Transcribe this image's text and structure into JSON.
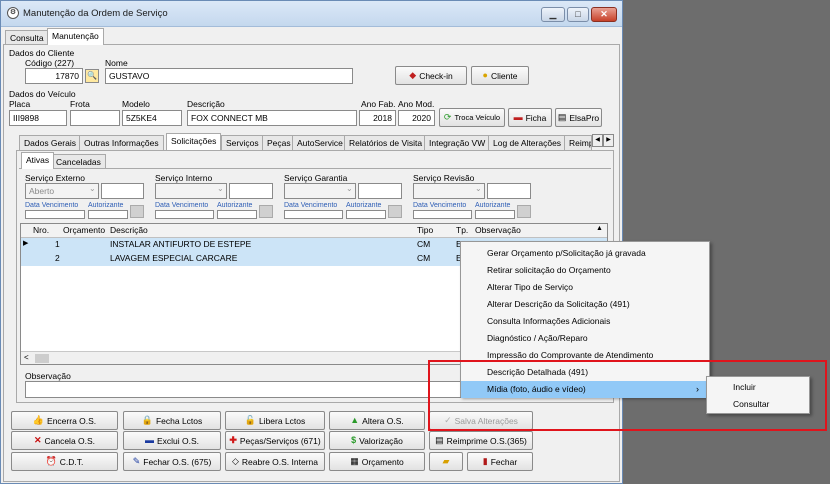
{
  "window": {
    "title": "Manutenção da Ordem de Serviço",
    "buttons": {
      "minimize": "▁",
      "maximize": "□",
      "close": "✕"
    }
  },
  "top_tabs": [
    "Consulta",
    "Manutenção"
  ],
  "cliente": {
    "section": "Dados do Cliente",
    "codigo_label": "Código (227)",
    "codigo": "17870",
    "nome_label": "Nome",
    "nome": "GUSTAVO",
    "checkin_label": "Check-in",
    "cliente_label": "Cliente"
  },
  "veiculo": {
    "section": "Dados do Veículo",
    "placa_label": "Placa",
    "placa": "III9898",
    "frota_label": "Frota",
    "frota": "",
    "modelo_label": "Modelo",
    "modelo": "5Z5KE4",
    "descricao_label": "Descrição",
    "descricao": "FOX CONNECT MB",
    "anofab_label": "Ano Fab.",
    "anofab": "2018",
    "anomod_label": "Ano Mod.",
    "anomod": "2020",
    "troca_label": "Troca Veículo",
    "ficha_label": "Ficha",
    "elsapro_label": "ElsaPro"
  },
  "main_tabs": [
    "Dados Gerais",
    "Outras Informações",
    "Solicitações",
    "Serviços",
    "Peças",
    "AutoService",
    "Relatórios de Visita",
    "Integração VW",
    "Log de Alterações",
    "Reimp"
  ],
  "sub_tabs": [
    "Ativas",
    "Canceladas"
  ],
  "servicos": [
    {
      "title": "Serviço Externo",
      "value": "Aberto"
    },
    {
      "title": "Serviço Interno",
      "value": ""
    },
    {
      "title": "Serviço Garantia",
      "value": ""
    },
    {
      "title": "Serviço Revisão",
      "value": ""
    }
  ],
  "data_vencimento": "Data Vencimento",
  "autorizante": "Autorizante",
  "grid": {
    "headers": {
      "nro": "Nro.",
      "orcamento": "Orçamento",
      "descricao": "Descrição",
      "tipo": "Tipo",
      "tp": "Tp.",
      "observacao": "Observação"
    },
    "rows": [
      {
        "nro": "1",
        "orcamento": "",
        "descricao": "INSTALAR ANTIFURTO DE ESTEPE",
        "tipo": "CM",
        "tp": "E"
      },
      {
        "nro": "2",
        "orcamento": "",
        "descricao": "LAVAGEM ESPECIAL CARCARE",
        "tipo": "CM",
        "tp": "E"
      }
    ]
  },
  "observacao_label": "Observação",
  "bottom_buttons": {
    "encerra": "Encerra O.S.",
    "fecha_lctos": "Fecha Lctos",
    "libera_lctos": "Libera Lctos",
    "altera": "Altera O.S.",
    "salva": "Salva Alterações",
    "cancela": "Cancela O.S.",
    "exclui": "Exclui O.S.",
    "pecas_servicos": "Peças/Serviços (671)",
    "valorizacao": "Valorização",
    "reimprime": "Reimprime O.S.(365)",
    "cdt": "C.D.T.",
    "fechar_os": "Fechar O.S. (675)",
    "reabre": "Reabre O.S. Interna",
    "orcamento": "Orçamento",
    "fechar": "Fechar"
  },
  "context_menu": [
    "Gerar Orçamento p/Solicitação já gravada",
    "Retirar solicitação do Orçamento",
    "Alterar Tipo de Serviço",
    "Alterar Descrição da Solicitação (491)",
    "Consulta Informações Adicionais",
    "Diagnóstico / Ação/Reparo",
    "Impressão do Comprovante de Atendimento",
    "Descrição Detalhada (491)",
    "Mídia (foto, áudio e vídeo)"
  ],
  "submenu": [
    "Incluir",
    "Consultar"
  ],
  "colors": {
    "highlight": "#91c9f7",
    "row_selected": "#cce4f7",
    "annotation": "#e0141c"
  }
}
